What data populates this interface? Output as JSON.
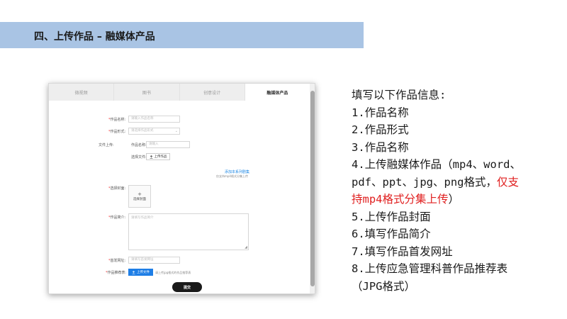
{
  "header": {
    "title": "四、上传作品 – 融媒体产品"
  },
  "tabs": [
    {
      "label": "微视频"
    },
    {
      "label": "图书"
    },
    {
      "label": "创意设计"
    },
    {
      "label": "融媒体产品"
    }
  ],
  "form": {
    "name_label": "作品名称:",
    "name_placeholder": "请输入作品名称",
    "form_label": "作品形式:",
    "form_placeholder": "请选择作品形式",
    "file_upload_label": "文件上传:",
    "file_name_label": "作品名称:",
    "file_name_placeholder": "请输入",
    "choose_file_label": "选择文件:",
    "upload_work_button": "上传作品",
    "add_episode_link": "添加本系列剧集",
    "add_episode_hint": "仅支持mp4格式分集上传",
    "cover_label": "选择封面:",
    "cover_upload_text": "选择封面",
    "intro_label": "作品简介:",
    "intro_placeholder": "请填写作品简介",
    "first_url_label": "首发网址:",
    "first_url_placeholder": "请填写首发网址",
    "recommend_label": "作品推荐表:",
    "upload_file_button": "上传文件",
    "recommend_hint": "请上传jpg格式的作品推荐表",
    "submit_button": "提交"
  },
  "instructions": {
    "heading": "填写以下作品信息:",
    "item1": "1.作品名称",
    "item2": "2.作品形式",
    "item3": "3.作品名称",
    "item4_line1": "4.上传融媒体作品（mp4、word、",
    "item4_line2_normal": "pdf、ppt、jpg、png格式，",
    "item4_line2_red": "仅支",
    "item4_line3_red": "持mp4格式分集上传",
    "item4_line3_end": "）",
    "item5": "5.上传作品封面",
    "item6": "6.填写作品简介",
    "item7": "7.填写作品首发网址",
    "item8_line1": "8.上传应急管理科普作品推荐表",
    "item8_line2": "（JPG格式）"
  },
  "colors": {
    "header_bar": "#a9c4e4",
    "link_blue": "#1e88e5",
    "upload_blue": "#1e7ee6",
    "highlight_red": "#e02020",
    "submit_dark": "#1a1a1a"
  },
  "icons": {
    "upload": "upload-icon",
    "plus": "plus-icon",
    "chevron": "chevron-down-icon"
  }
}
